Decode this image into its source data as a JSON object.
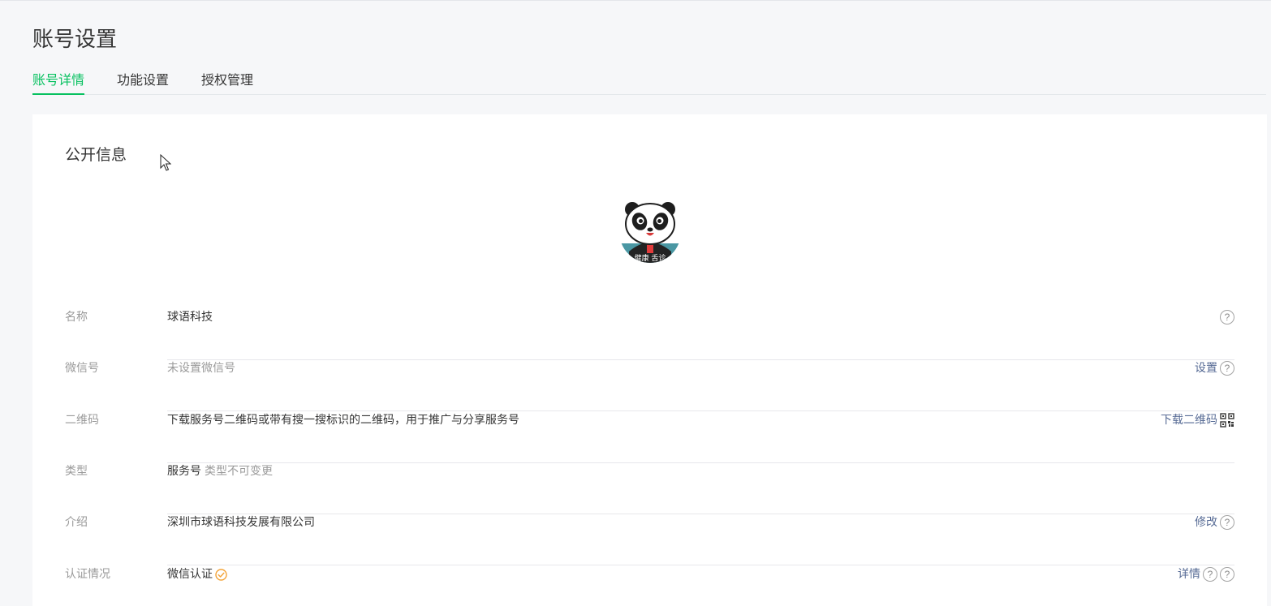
{
  "header": {
    "title": "账号设置",
    "tabs": [
      {
        "label": "账号详情",
        "active": true
      },
      {
        "label": "功能设置",
        "active": false
      },
      {
        "label": "授权管理",
        "active": false
      }
    ]
  },
  "public_info": {
    "title": "公开信息",
    "avatar_icon": "panda-avatar-icon",
    "avatar_caption": "健康 舌诊",
    "rows": [
      {
        "label": "名称",
        "value": "球语科技"
      },
      {
        "label": "微信号",
        "value": "未设置微信号",
        "action": "设置"
      },
      {
        "label": "二维码",
        "value": "下载服务号二维码或带有搜一搜标识的二维码，用于推广与分享服务号",
        "action": "下载二维码"
      },
      {
        "label": "类型",
        "value": "服务号",
        "sub": "类型不可变更"
      },
      {
        "label": "介绍",
        "value": "深圳市球语科技发展有限公司",
        "action": "修改"
      },
      {
        "label": "认证情况",
        "value": "微信认证",
        "action": "详情"
      }
    ]
  },
  "colors": {
    "accent": "#07c160",
    "link": "#576b95",
    "verified": "#f3a43a"
  }
}
